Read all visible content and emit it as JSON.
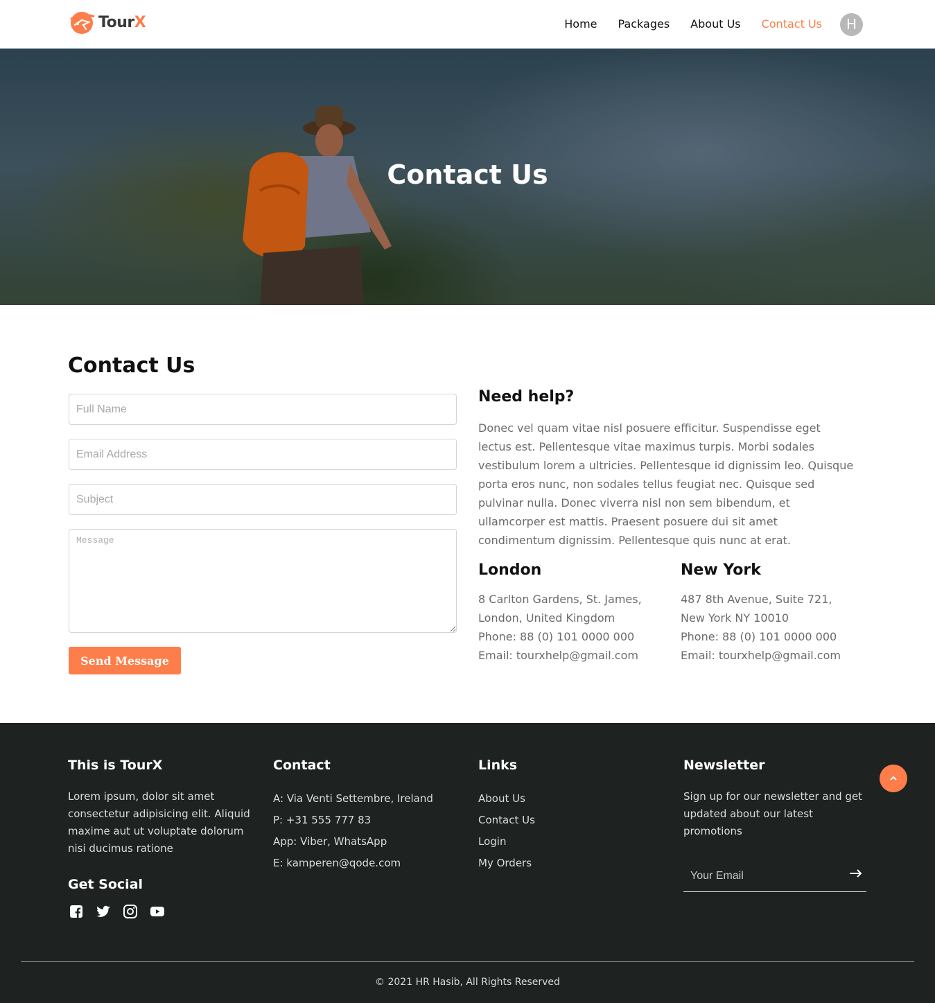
{
  "brand": {
    "name_a": "Tour",
    "name_b": "X",
    "accent": "#fd7e4a"
  },
  "nav": {
    "items": [
      {
        "label": "Home",
        "active": false
      },
      {
        "label": "Packages",
        "active": false
      },
      {
        "label": "About Us",
        "active": false
      },
      {
        "label": "Contact Us",
        "active": true
      }
    ],
    "avatar_initial": "H"
  },
  "hero": {
    "title": "Contact Us"
  },
  "contact_form": {
    "title": "Contact Us",
    "full_name_placeholder": "Full Name",
    "email_placeholder": "Email Address",
    "subject_placeholder": "Subject",
    "message_placeholder": "Message",
    "send_label": "Send Message"
  },
  "help": {
    "title": "Need help?",
    "text": "Donec vel quam vitae nisl posuere efficitur. Suspendisse eget lectus est. Pellentesque vitae maximus turpis. Morbi sodales vestibulum lorem a ultricies. Pellentesque id dignissim leo. Quisque porta eros nunc, non sodales tellus feugiat nec. Quisque sed pulvinar nulla. Donec viverra nisl non sem bibendum, et ullamcorper est mattis. Praesent posuere dui sit amet condimentum dignissim. Pellentesque quis nunc at erat."
  },
  "offices": [
    {
      "city": "London",
      "address": "8 Carlton Gardens, St. James, London, United Kingdom",
      "phone": "Phone: 88 (0) 101 0000 000",
      "email": "Email: tourxhelp@gmail.com"
    },
    {
      "city": "New York",
      "address": "487 8th Avenue, Suite 721, New York NY 10010",
      "phone": "Phone: 88 (0) 101 0000 000",
      "email": "Email: tourxhelp@gmail.com"
    }
  ],
  "footer": {
    "about": {
      "title": "This is TourX",
      "text": "Lorem ipsum, dolor sit amet consectetur adipisicing elit. Aliquid maxime aut ut voluptate dolorum nisi ducimus ratione"
    },
    "social": {
      "title": "Get Social",
      "icons": [
        "facebook-icon",
        "twitter-icon",
        "instagram-icon",
        "youtube-icon"
      ]
    },
    "contact": {
      "title": "Contact",
      "lines": [
        "A: Via Venti Settembre, Ireland",
        "P: +31 555 777 83",
        "App: Viber, WhatsApp",
        "E: kamperen@qode.com"
      ]
    },
    "links": {
      "title": "Links",
      "items": [
        "About Us",
        "Contact Us",
        "Login",
        "My Orders"
      ]
    },
    "newsletter": {
      "title": "Newsletter",
      "text": "Sign up for our newsletter and get updated about our latest promotions",
      "placeholder": "Your Email"
    },
    "copyright": "© 2021 HR Hasib, All Rights Reserved"
  }
}
